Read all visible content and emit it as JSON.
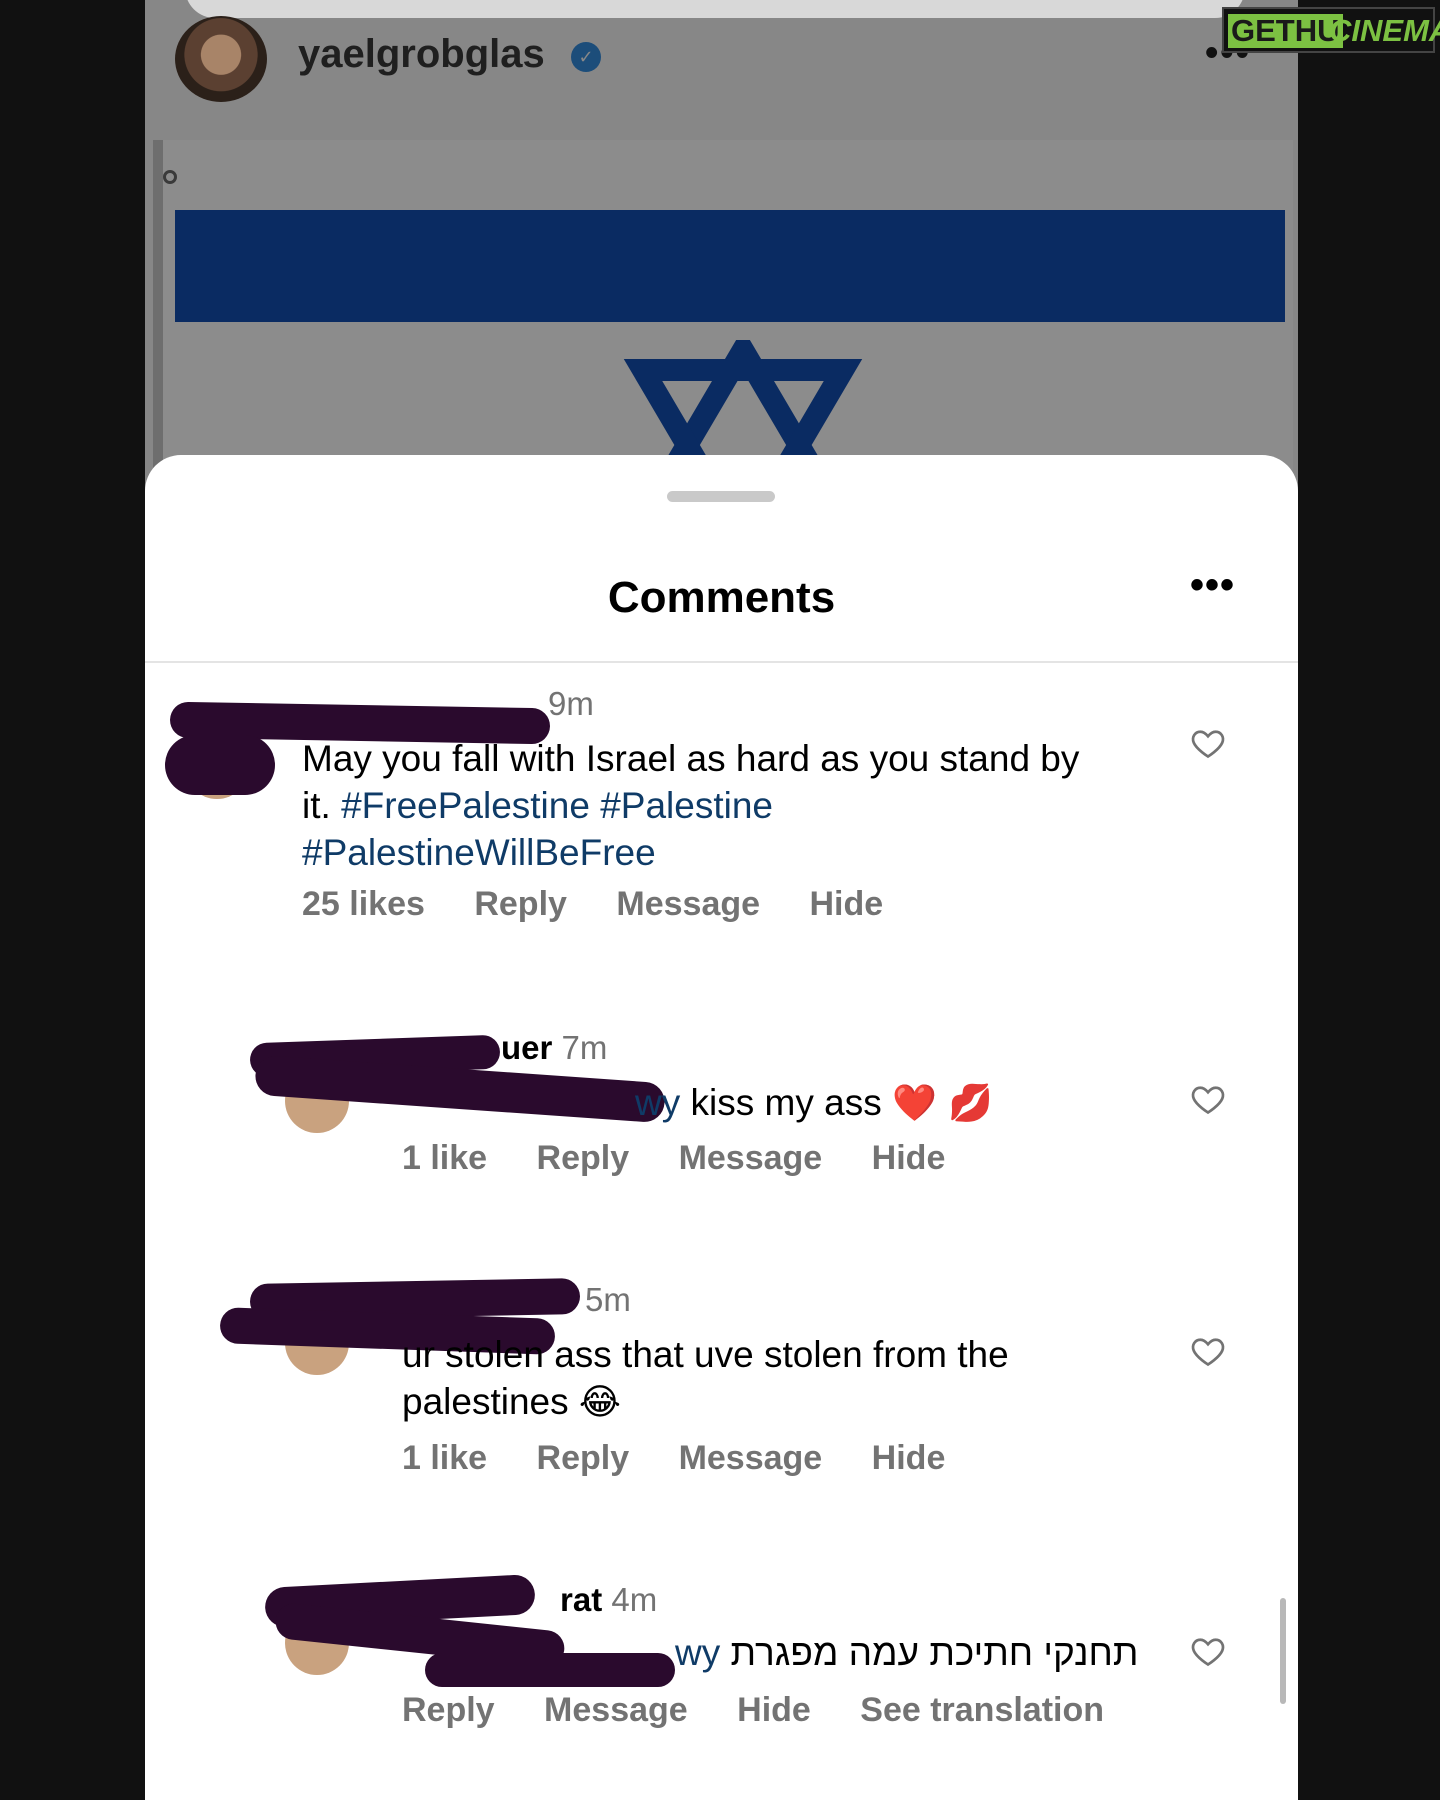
{
  "post": {
    "username": "yaelgrobglas",
    "verified_icon": "verified-badge-icon",
    "more_label": "•••"
  },
  "sheet": {
    "title": "Comments",
    "more_label": "•••"
  },
  "comments": [
    {
      "time": "9m",
      "text_plain": "May you fall with Israel as hard as you stand by it. ",
      "hashtags": [
        "#FreePalestine",
        "#Palestine",
        "#PalestineWillBeFree"
      ],
      "likes": "25 likes",
      "reply": "Reply",
      "message": "Message",
      "hide": "Hide"
    },
    {
      "author_fragment": "uer",
      "time": "7m",
      "mention_fragment": "wy",
      "text": " kiss my ass ",
      "emoji": "❤️ 💋",
      "likes": "1 like",
      "reply": "Reply",
      "message": "Message",
      "hide": "Hide"
    },
    {
      "time": "5m",
      "text": "ur stolen ass that uve stolen from the palestines ",
      "emoji": "😂",
      "likes": "1 like",
      "reply": "Reply",
      "message": "Message",
      "hide": "Hide"
    },
    {
      "author_fragment": "rat",
      "time": "4m",
      "mention_fragment": "wy",
      "text": "תחנקי חתיכת עמה מפגרת",
      "reply": "Reply",
      "message": "Message",
      "hide": "Hide",
      "translation": "See translation"
    }
  ],
  "watermark": {
    "part_a": "GETHU",
    "part_b": "CINEMA"
  },
  "colors": {
    "hashtag": "#0f3b67",
    "meta_gray": "#737373",
    "redaction": "#2a0a2d",
    "watermark_green": "#7cc142"
  }
}
